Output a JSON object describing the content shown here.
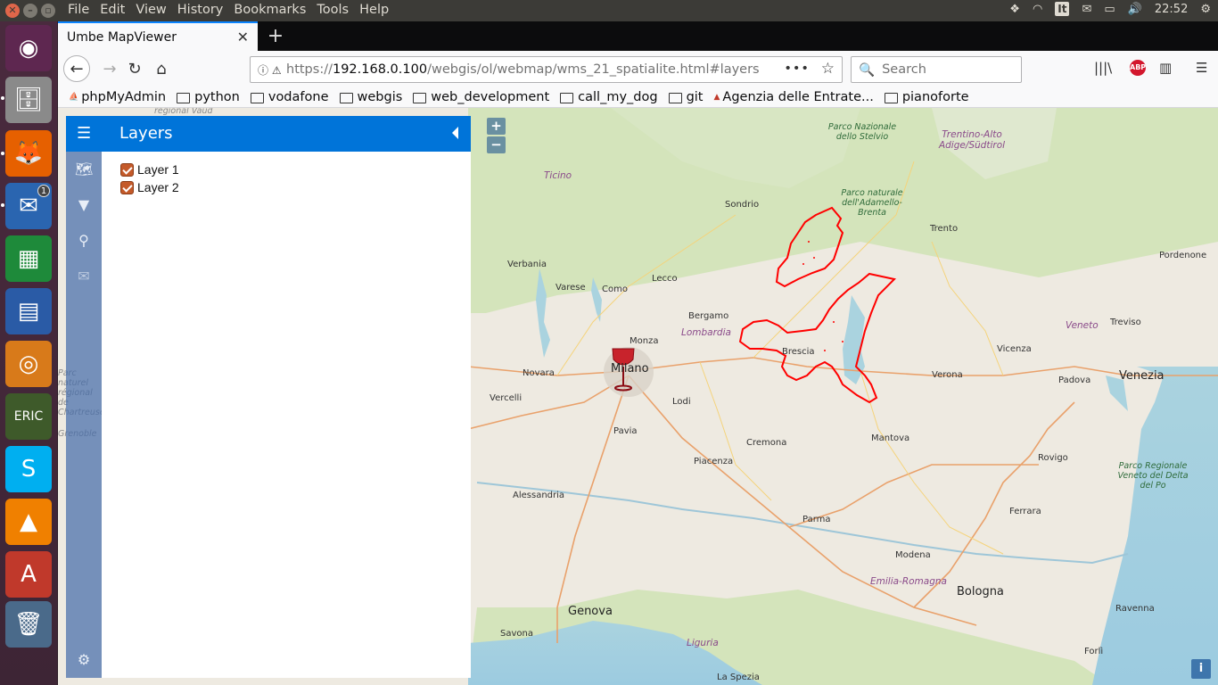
{
  "topbar": {
    "menus": [
      "File",
      "Edit",
      "View",
      "History",
      "Bookmarks",
      "Tools",
      "Help"
    ],
    "keyboard_layout": "It",
    "clock": "22:52"
  },
  "browser": {
    "tab_title": "Umbe MapViewer",
    "url_prefix": "https://",
    "url_host": "192.168.0.100",
    "url_path": "/webgis/ol/webmap/wms_21_spatialite.html#layers",
    "search_placeholder": "Search",
    "abp_label": "ABP",
    "bookmarks": [
      {
        "label": "phpMyAdmin",
        "icon": "pma"
      },
      {
        "label": "python",
        "icon": "folder"
      },
      {
        "label": "vodafone",
        "icon": "folder"
      },
      {
        "label": "webgis",
        "icon": "folder"
      },
      {
        "label": "web_development",
        "icon": "folder"
      },
      {
        "label": "call_my_dog",
        "icon": "folder"
      },
      {
        "label": "git",
        "icon": "folder"
      },
      {
        "label": "Agenzia delle Entrate...",
        "icon": "agenzia"
      },
      {
        "label": "pianoforte",
        "icon": "folder"
      }
    ]
  },
  "sidebar": {
    "title": "Layers",
    "layers": [
      {
        "label": "Layer 1",
        "checked": true
      },
      {
        "label": "Layer 2",
        "checked": true
      }
    ]
  },
  "map": {
    "zoom_in": "+",
    "zoom_out": "−",
    "attribution": "i",
    "labels": {
      "vaud": "regional Vaud",
      "ticino": "Ticino",
      "stelvio": "Parco Nazionale dello Stelvio",
      "trentino": "Trentino-Alto Adige/Südtirol",
      "sondrio": "Sondrio",
      "adamello": "Parco naturale dell'Adamello-Brenta",
      "trento": "Trento",
      "pordenone": "Pordenone",
      "verbania": "Verbania",
      "varese": "Varese",
      "como": "Como",
      "lecco": "Lecco",
      "bergamo": "Bergamo",
      "lombardia": "Lombardia",
      "treviso": "Treviso",
      "veneto": "Veneto",
      "monza": "Monza",
      "vicenza": "Vicenza",
      "venezia": "Venezia",
      "novara": "Novara",
      "milano": "Milano",
      "brescia": "Brescia",
      "verona": "Verona",
      "padova": "Padova",
      "vercelli": "Vercelli",
      "lodi": "Lodi",
      "pavia": "Pavia",
      "cremona": "Cremona",
      "mantova": "Mantova",
      "piacenza": "Piacenza",
      "rovigo": "Rovigo",
      "delta_po": "Parco Regionale Veneto del Delta del Po",
      "alessandria": "Alessandria",
      "parma": "Parma",
      "ferrara": "Ferrara",
      "modena": "Modena",
      "emilia": "Emilia-Romagna",
      "bologna": "Bologna",
      "genova": "Genova",
      "ravenna": "Ravenna",
      "savona": "Savona",
      "liguria": "Liguria",
      "forli": "Forlì",
      "spezia": "La Spezia",
      "chartreuse": "Parc naturel régional de Chartreuse",
      "grenoble": "Grenoble"
    }
  },
  "colors": {
    "sidebar_header": "#0074d9",
    "layer_outline": "#ff0000",
    "checkbox": "#c45a2a"
  }
}
